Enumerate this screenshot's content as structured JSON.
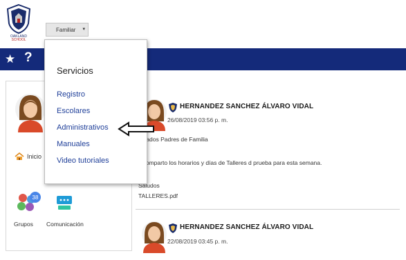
{
  "header": {
    "logo_text": "OAKLAND SCHOOL",
    "role_select": {
      "value": "Familiar",
      "caret": "▾"
    }
  },
  "navbar": {
    "star_icon": "★",
    "help_icon": "?"
  },
  "sidebar": {
    "nav": [
      {
        "label": "Inicio",
        "icon": "house-icon"
      }
    ],
    "apps": [
      {
        "label": "Grupos",
        "badge": "38",
        "icon": "groups-icon"
      },
      {
        "label": "Comunicación",
        "icon": "chat-icon"
      }
    ]
  },
  "dropdown": {
    "title": "Servicios",
    "items": [
      {
        "label": "Registro"
      },
      {
        "label": "Escolares"
      },
      {
        "label": "Administrativos"
      },
      {
        "label": "Manuales"
      },
      {
        "label": "Video tutoriales"
      }
    ]
  },
  "feed": {
    "posts": [
      {
        "author": "HERNANDEZ SANCHEZ ÁLVARO VIDAL",
        "date": "26/08/2019 03:56 p. m.",
        "lines": [
          "timados Padres de Familia",
          "s comparto los horarios y días de Talleres d prueba para esta semana.",
          "Saludos"
        ],
        "attachment": "TALLERES.pdf"
      },
      {
        "author": "HERNANDEZ SANCHEZ ÁLVARO VIDAL",
        "date": "22/08/2019 03:45 p. m."
      }
    ]
  },
  "colors": {
    "navbar": "#142a7a",
    "link": "#1f3f99",
    "badge": "#4a86e8"
  }
}
